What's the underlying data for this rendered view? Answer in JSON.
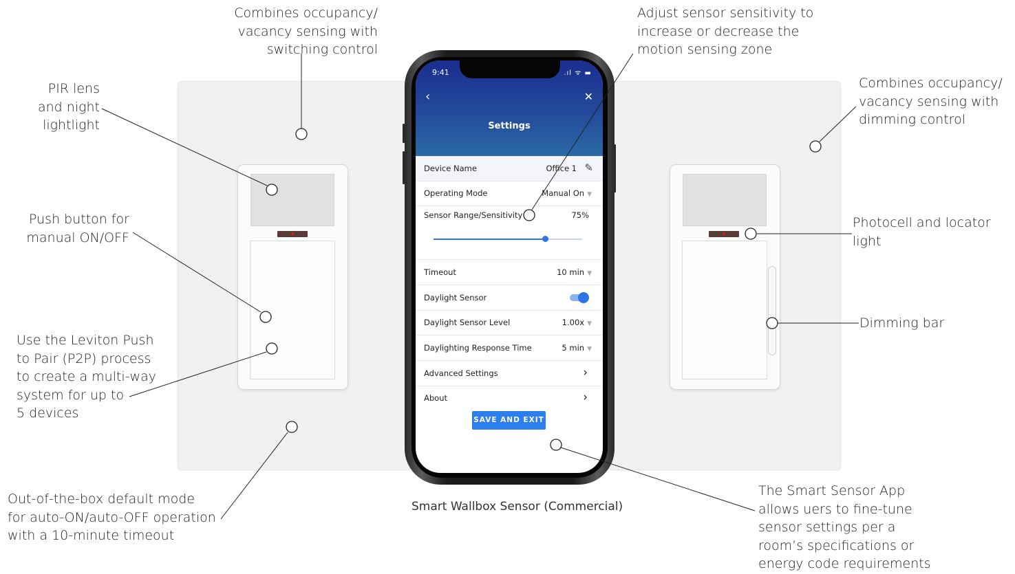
{
  "callouts": {
    "switching": "Combines occupancy/\nvacancy sensing with\nswitching control",
    "pir": "PIR lens\nand night\nlightlight",
    "push": "Push button for\nmanual ON/OFF",
    "p2p": "Use the Leviton Push\nto Pair (P2P) process\nto create a multi-way\nsystem for up to\n5 devices",
    "default_mode": "Out-of-the-box default mode\nfor auto-ON/auto-OFF operation\nwith a 10-minute timeout",
    "sensitivity": "Adjust sensor sensitivity to\nincrease or decrease the\nmotion sensing zone",
    "dimming_ctrl": "Combines occupancy/\nvacancy sensing with\ndimming control",
    "photocell": "Photocell and locator\nlight",
    "dimming_bar": "Dimming bar",
    "app": "The Smart Sensor App\nallows uers to fine-tune\nsensor settings per a\nroom’s specifications or\nenergy code requirements"
  },
  "caption": "Smart Wallbox Sensor (Commercial)",
  "phone": {
    "status_time": "9:41",
    "status_icons": ".ıl ᯤ ▬",
    "back_icon": "‹",
    "close_icon": "✕",
    "title": "Settings",
    "device_name_label": "Device Name",
    "device_name_value": "Office 1",
    "operating_mode_label": "Operating Mode",
    "operating_mode_value": "Manual On",
    "sensor_range_label": "Sensor Range/Sensitivity",
    "sensor_range_value": "75%",
    "sensor_range_fraction": 0.75,
    "timeout_label": "Timeout",
    "timeout_value": "10 min",
    "daylight_sensor_label": "Daylight Sensor",
    "daylight_sensor_on": true,
    "daylight_level_label": "Daylight Sensor Level",
    "daylight_level_value": "1.00x",
    "daylight_response_label": "Daylighting Response Time",
    "daylight_response_value": "5 min",
    "advanced_label": "Advanced Settings",
    "about_label": "About",
    "save_label": "SAVE AND EXIT"
  },
  "colors": {
    "header_top": "#1a2d8f",
    "header_bottom": "#2a6aa6",
    "accent_blue": "#2f73e8",
    "plate": "#f1f1f1"
  }
}
